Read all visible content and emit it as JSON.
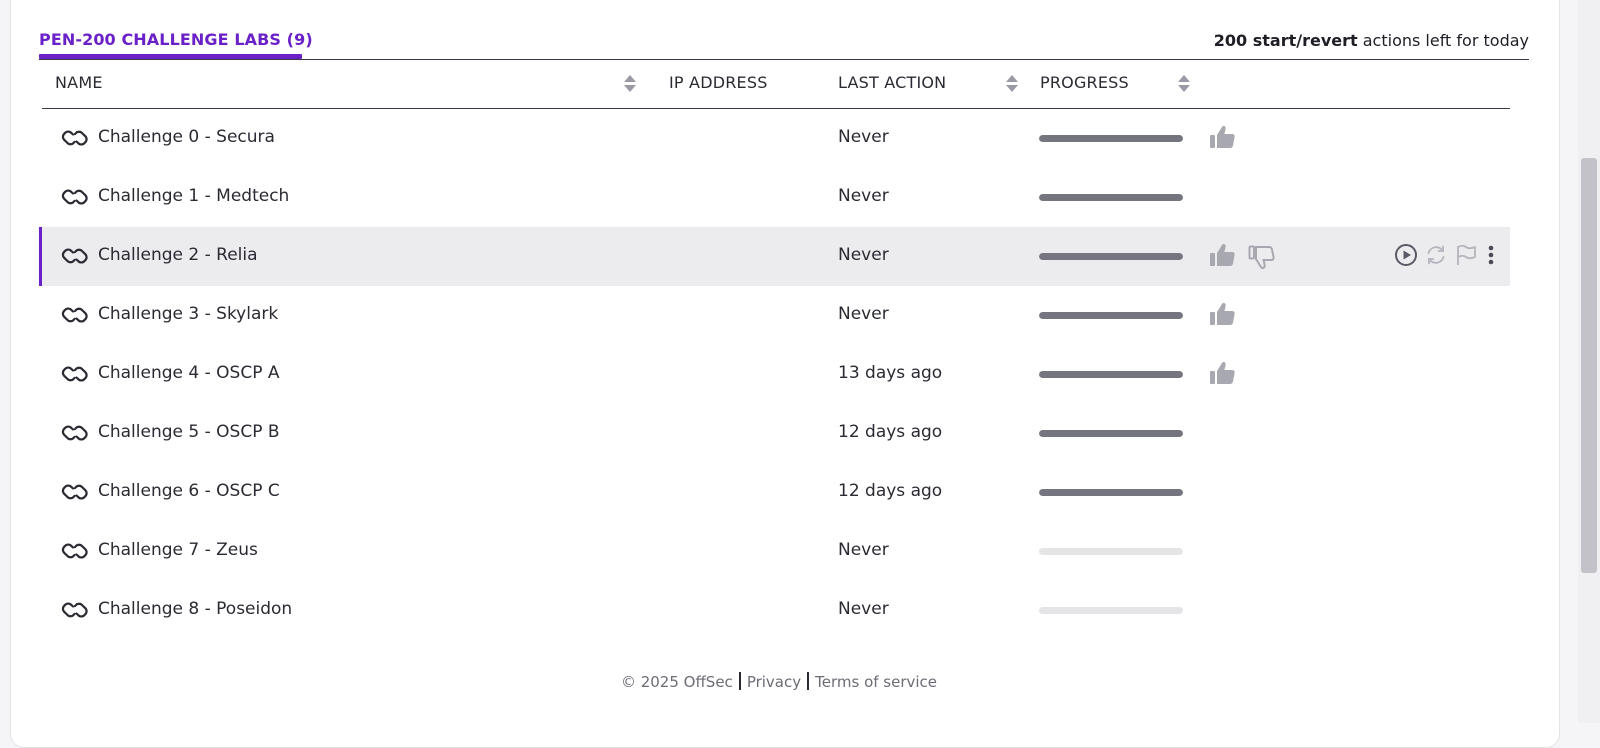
{
  "tab": {
    "title": "PEN-200 CHALLENGE LABS (9)",
    "accent_color": "#6b21c8"
  },
  "actions_left": {
    "count_label": "200 start/revert",
    "suffix": " actions left for today"
  },
  "columns": {
    "name": "NAME",
    "ip_address": "IP ADDRESS",
    "last_action": "LAST ACTION",
    "progress": "PROGRESS"
  },
  "rows": [
    {
      "name": "Challenge 0 - Secura",
      "ip": "",
      "last_action": "Never",
      "progress": 1.0,
      "thumb_up": true
    },
    {
      "name": "Challenge 1 - Medtech",
      "ip": "",
      "last_action": "Never",
      "progress": 1.0,
      "thumb_up": false
    },
    {
      "name": "Challenge 2 - Relia",
      "ip": "",
      "last_action": "Never",
      "progress": 1.0,
      "thumb_up": true,
      "thumb_down": true,
      "highlighted": true
    },
    {
      "name": "Challenge 3 - Skylark",
      "ip": "",
      "last_action": "Never",
      "progress": 1.0,
      "thumb_up": true
    },
    {
      "name": "Challenge 4 - OSCP A",
      "ip": "",
      "last_action": "13 days ago",
      "progress": 1.0,
      "thumb_up": true
    },
    {
      "name": "Challenge 5 - OSCP B",
      "ip": "",
      "last_action": "12 days ago",
      "progress": 1.0,
      "thumb_up": false
    },
    {
      "name": "Challenge 6 - OSCP C",
      "ip": "",
      "last_action": "12 days ago",
      "progress": 1.0,
      "thumb_up": false
    },
    {
      "name": "Challenge 7 - Zeus",
      "ip": "",
      "last_action": "Never",
      "progress": 0.0,
      "thumb_up": false
    },
    {
      "name": "Challenge 8 - Poseidon",
      "ip": "",
      "last_action": "Never",
      "progress": 0.0,
      "thumb_up": false
    }
  ],
  "row_action_icons": [
    "play-icon",
    "revert-icon",
    "flag-icon",
    "more-vertical-icon"
  ],
  "footer": {
    "copyright": "© 2025  OffSec",
    "privacy": "Privacy",
    "terms": "Terms of service"
  },
  "colors": {
    "progress_fill": "#75757f",
    "progress_track": "#e5e5e8",
    "highlight_row": "#ececef",
    "icon_gray": "#a8a8b0"
  }
}
